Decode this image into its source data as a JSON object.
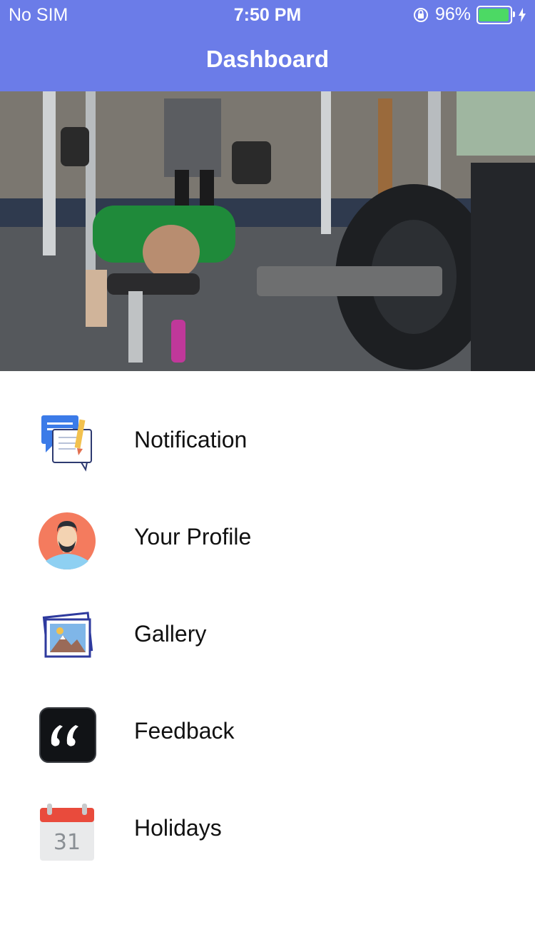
{
  "status_bar": {
    "carrier": "No SIM",
    "time": "7:50 PM",
    "battery_percent": "96%",
    "battery_level": 0.96
  },
  "nav": {
    "title": "Dashboard"
  },
  "hero": {
    "alt": "gym"
  },
  "menu": {
    "items": [
      {
        "label": "Notification",
        "icon": "notification-icon"
      },
      {
        "label": "Your Profile",
        "icon": "profile-avatar-icon"
      },
      {
        "label": "Gallery",
        "icon": "gallery-icon"
      },
      {
        "label": "Feedback",
        "icon": "quote-icon"
      },
      {
        "label": "Holidays",
        "icon": "calendar-icon"
      }
    ],
    "calendar_day": "31"
  },
  "colors": {
    "header": "#6b7ce8",
    "battery": "#4cd964",
    "profile_circle": "#f47b5e"
  }
}
